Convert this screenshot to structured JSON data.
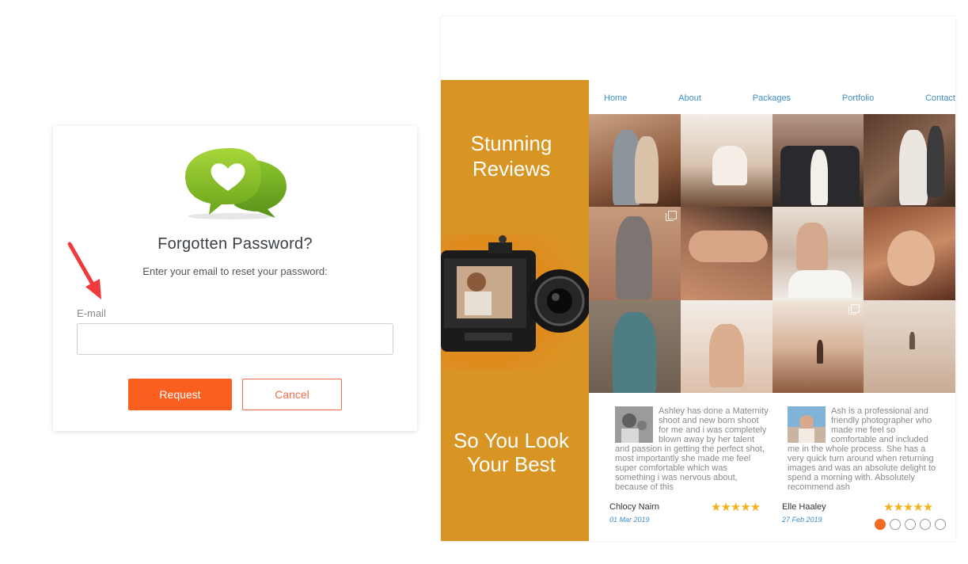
{
  "forgot_password": {
    "logo_icon": "chat-heart-icon",
    "title": "Forgotten Password?",
    "subtitle": "Enter your email to reset your password:",
    "email_label": "E-mail",
    "email_value": "",
    "request_label": "Request",
    "cancel_label": "Cancel",
    "accent_color": "#fb5f1f"
  },
  "site": {
    "side_heading_top": "Stunning Reviews",
    "side_heading_bottom": "So You Look Your Best",
    "side_color": "#d99523",
    "nav": [
      "Home",
      "About",
      "Packages",
      "Portfolio",
      "Contact"
    ],
    "reviews": [
      {
        "text": "Ashley has done a Maternity shoot and new born shoot for me and i was completely blown away by her talent and passion in getting the perfect shot, most importantly she made me feel super comfortable which was something i was nervous about, because of this",
        "name": "Chlocy Nairn",
        "date": "01 Mar 2019",
        "stars": "★★★★★"
      },
      {
        "text": "Ash is a professional and friendly photographer who made me feel so comfortable and included me in the whole process. She has a very quick turn around when returning images and was an absolute delight to spend a morning with. Absolutely recommend ash",
        "name": "Elle Haaley",
        "date": "27 Feb 2019",
        "stars": "★★★★★"
      }
    ],
    "carousel_pages": 5,
    "carousel_active": 1
  }
}
